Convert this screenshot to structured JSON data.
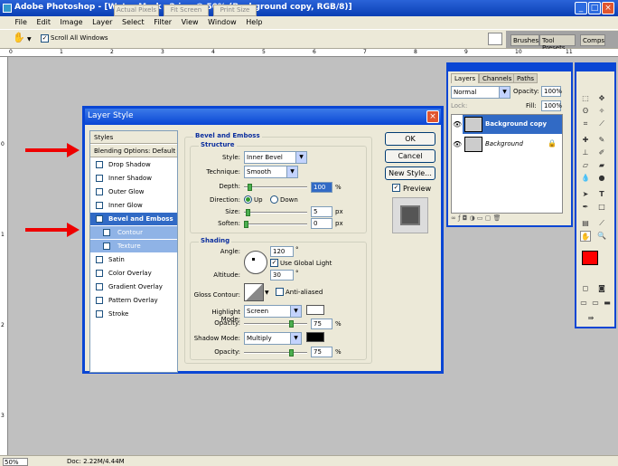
{
  "window": {
    "title": "Adobe Photoshop - [Water Mark v2.jpg @ 50% (Background copy, RGB/8)]"
  },
  "menu": [
    "File",
    "Edit",
    "Image",
    "Layer",
    "Select",
    "Filter",
    "View",
    "Window",
    "Help"
  ],
  "options_bar": {
    "scroll_all": "Scroll All Windows",
    "actual_pixels": "Actual Pixels",
    "fit_screen": "Fit Screen",
    "print_size": "Print Size"
  },
  "palette_well": {
    "brushes": "Brushes",
    "tool_presets": "Tool Presets",
    "comps": "Comps"
  },
  "ruler": {
    "top_marks": [
      "0",
      "1",
      "2",
      "3",
      "4",
      "5",
      "6",
      "7",
      "8",
      "9",
      "10",
      "11"
    ],
    "left_marks": [
      "0",
      "1",
      "2",
      "3",
      "4",
      "5",
      "6"
    ]
  },
  "status": {
    "zoom": "50%",
    "doc": "Doc: 2.22M/4.44M"
  },
  "dialog": {
    "title": "Layer Style",
    "styles_header": "Styles",
    "blending": "Blending Options: Default",
    "items": [
      {
        "label": "Drop Shadow",
        "checked": false
      },
      {
        "label": "Inner Shadow",
        "checked": false
      },
      {
        "label": "Outer Glow",
        "checked": false
      },
      {
        "label": "Inner Glow",
        "checked": false
      },
      {
        "label": "Bevel and Emboss",
        "checked": true
      },
      {
        "label": "Contour",
        "checked": true
      },
      {
        "label": "Texture",
        "checked": false
      },
      {
        "label": "Satin",
        "checked": false
      },
      {
        "label": "Color Overlay",
        "checked": false
      },
      {
        "label": "Gradient Overlay",
        "checked": false
      },
      {
        "label": "Pattern Overlay",
        "checked": false
      },
      {
        "label": "Stroke",
        "checked": false
      }
    ],
    "bevel_title": "Bevel and Emboss",
    "structure_title": "Structure",
    "style_label": "Style:",
    "style_value": "Inner Bevel",
    "technique_label": "Technique:",
    "technique_value": "Smooth",
    "depth_label": "Depth:",
    "depth_value": "100",
    "depth_unit": "%",
    "direction_label": "Direction:",
    "dir_up": "Up",
    "dir_down": "Down",
    "size_label": "Size:",
    "size_value": "5",
    "size_unit": "px",
    "soften_label": "Soften:",
    "soften_value": "0",
    "soften_unit": "px",
    "shading_title": "Shading",
    "angle_label": "Angle:",
    "angle_value": "120",
    "deg": "°",
    "global_light": "Use Global Light",
    "altitude_label": "Altitude:",
    "altitude_value": "30",
    "gloss_label": "Gloss Contour:",
    "anti_aliased": "Anti-aliased",
    "highlight_label": "Highlight Mode:",
    "highlight_value": "Screen",
    "hl_opacity_label": "Opacity:",
    "hl_opacity_value": "75",
    "pct": "%",
    "shadow_label": "Shadow Mode:",
    "shadow_value": "Multiply",
    "sh_opacity_label": "Opacity:",
    "sh_opacity_value": "75",
    "ok": "OK",
    "cancel": "Cancel",
    "new_style": "New Style...",
    "preview": "Preview"
  },
  "layers_panel": {
    "tabs": [
      "Layers",
      "Channels",
      "Paths"
    ],
    "blend_mode": "Normal",
    "opacity_label": "Opacity:",
    "opacity_value": "100%",
    "lock_label": "Lock:",
    "fill_label": "Fill:",
    "fill_value": "100%",
    "layers": [
      {
        "name": "Background copy"
      },
      {
        "name": "Background"
      }
    ]
  },
  "colors": {
    "foreground": "#ff0000",
    "background": "#ffffff",
    "accent": "#316ac5",
    "arrows": "#e00000"
  }
}
